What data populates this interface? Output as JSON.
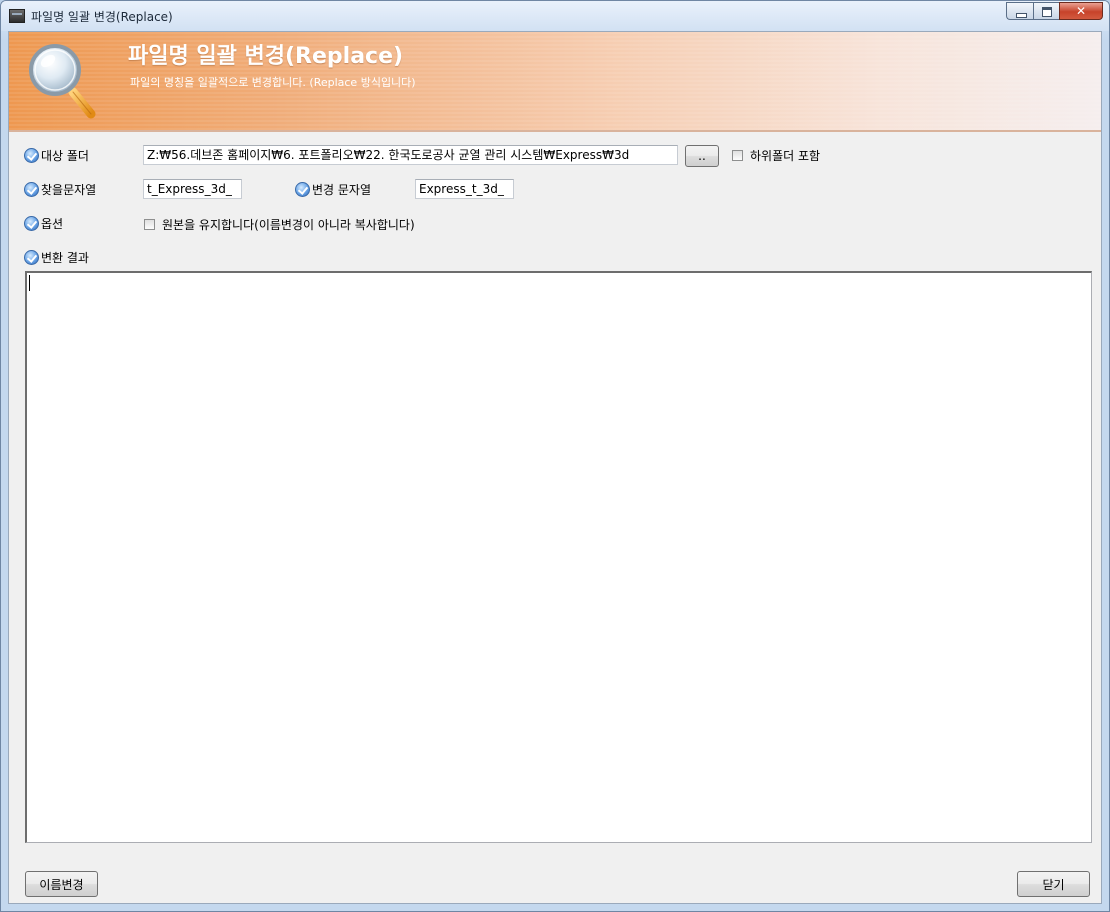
{
  "window": {
    "title": "파일명 일괄 변경(Replace)"
  },
  "banner": {
    "title": "파일명 일괄 변경(Replace)",
    "subtitle": "파일의 명칭을 일괄적으로 변경합니다. (Replace 방식입니다)",
    "icon": "magnifier-icon"
  },
  "form": {
    "target_folder_label": "대상 폴더",
    "target_folder_value": "Z:₩56.데브존 홈페이지₩6. 포트폴리오₩22. 한국도로공사 균열 관리 시스템₩Express₩3d",
    "browse_button": "..",
    "include_subfolders_label": "하위폴더 포함",
    "find_label": "찾을문자열",
    "find_value": "t_Express_3d_",
    "replace_label": "변경 문자열",
    "replace_value": "Express_t_3d_",
    "options_label": "옵션",
    "keep_original_label": "원본을 유지합니다(이름변경이 아니라 복사합니다)",
    "result_label": "변환 결과",
    "result_value": ""
  },
  "footer": {
    "rename_button": "이름변경",
    "close_button": "닫기"
  },
  "colors": {
    "banner_start": "#ee9850",
    "banner_end": "#f5eeee",
    "close_button_red": "#c7432a"
  }
}
